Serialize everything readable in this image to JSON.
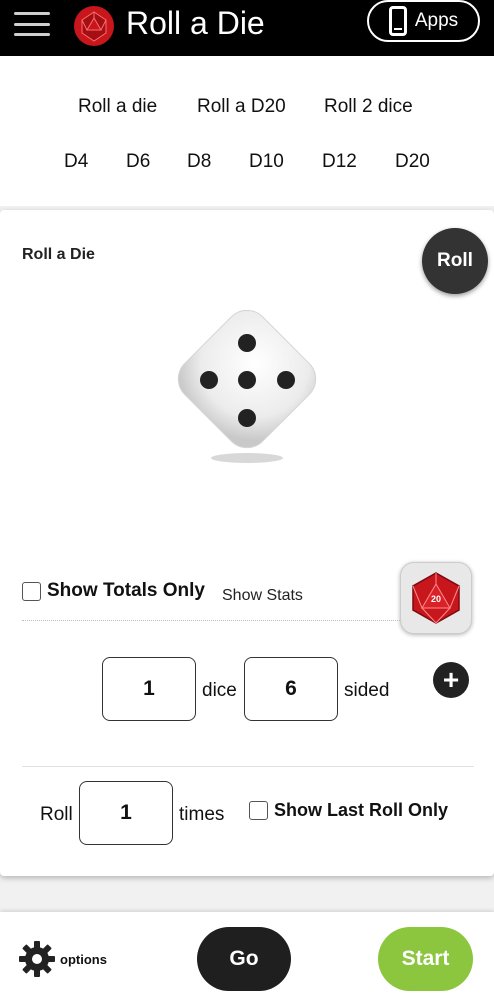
{
  "header": {
    "title": "Roll a Die",
    "apps_label": "Apps",
    "logo_color": "#c8161d"
  },
  "nav": {
    "row1": [
      "Roll a die",
      "Roll a D20",
      "Roll 2 dice"
    ],
    "row2": [
      "D4",
      "D6",
      "D8",
      "D10",
      "D12",
      "D20"
    ]
  },
  "card": {
    "title": "Roll a Die",
    "roll_label": "Roll",
    "die_face": 5,
    "show_totals_label": "Show Totals Only",
    "show_stats_label": "Show Stats",
    "d20_badge": "20",
    "dice_count": "1",
    "dice_label": "dice",
    "sides_count": "6",
    "sided_label": "sided",
    "plus_label": "+",
    "roll_prefix": "Roll",
    "times_value": "1",
    "times_label": "times",
    "show_last_label": "Show Last Roll Only"
  },
  "footer": {
    "options_label": "options",
    "go_label": "Go",
    "start_label": "Start",
    "start_color": "#8cc63f"
  }
}
